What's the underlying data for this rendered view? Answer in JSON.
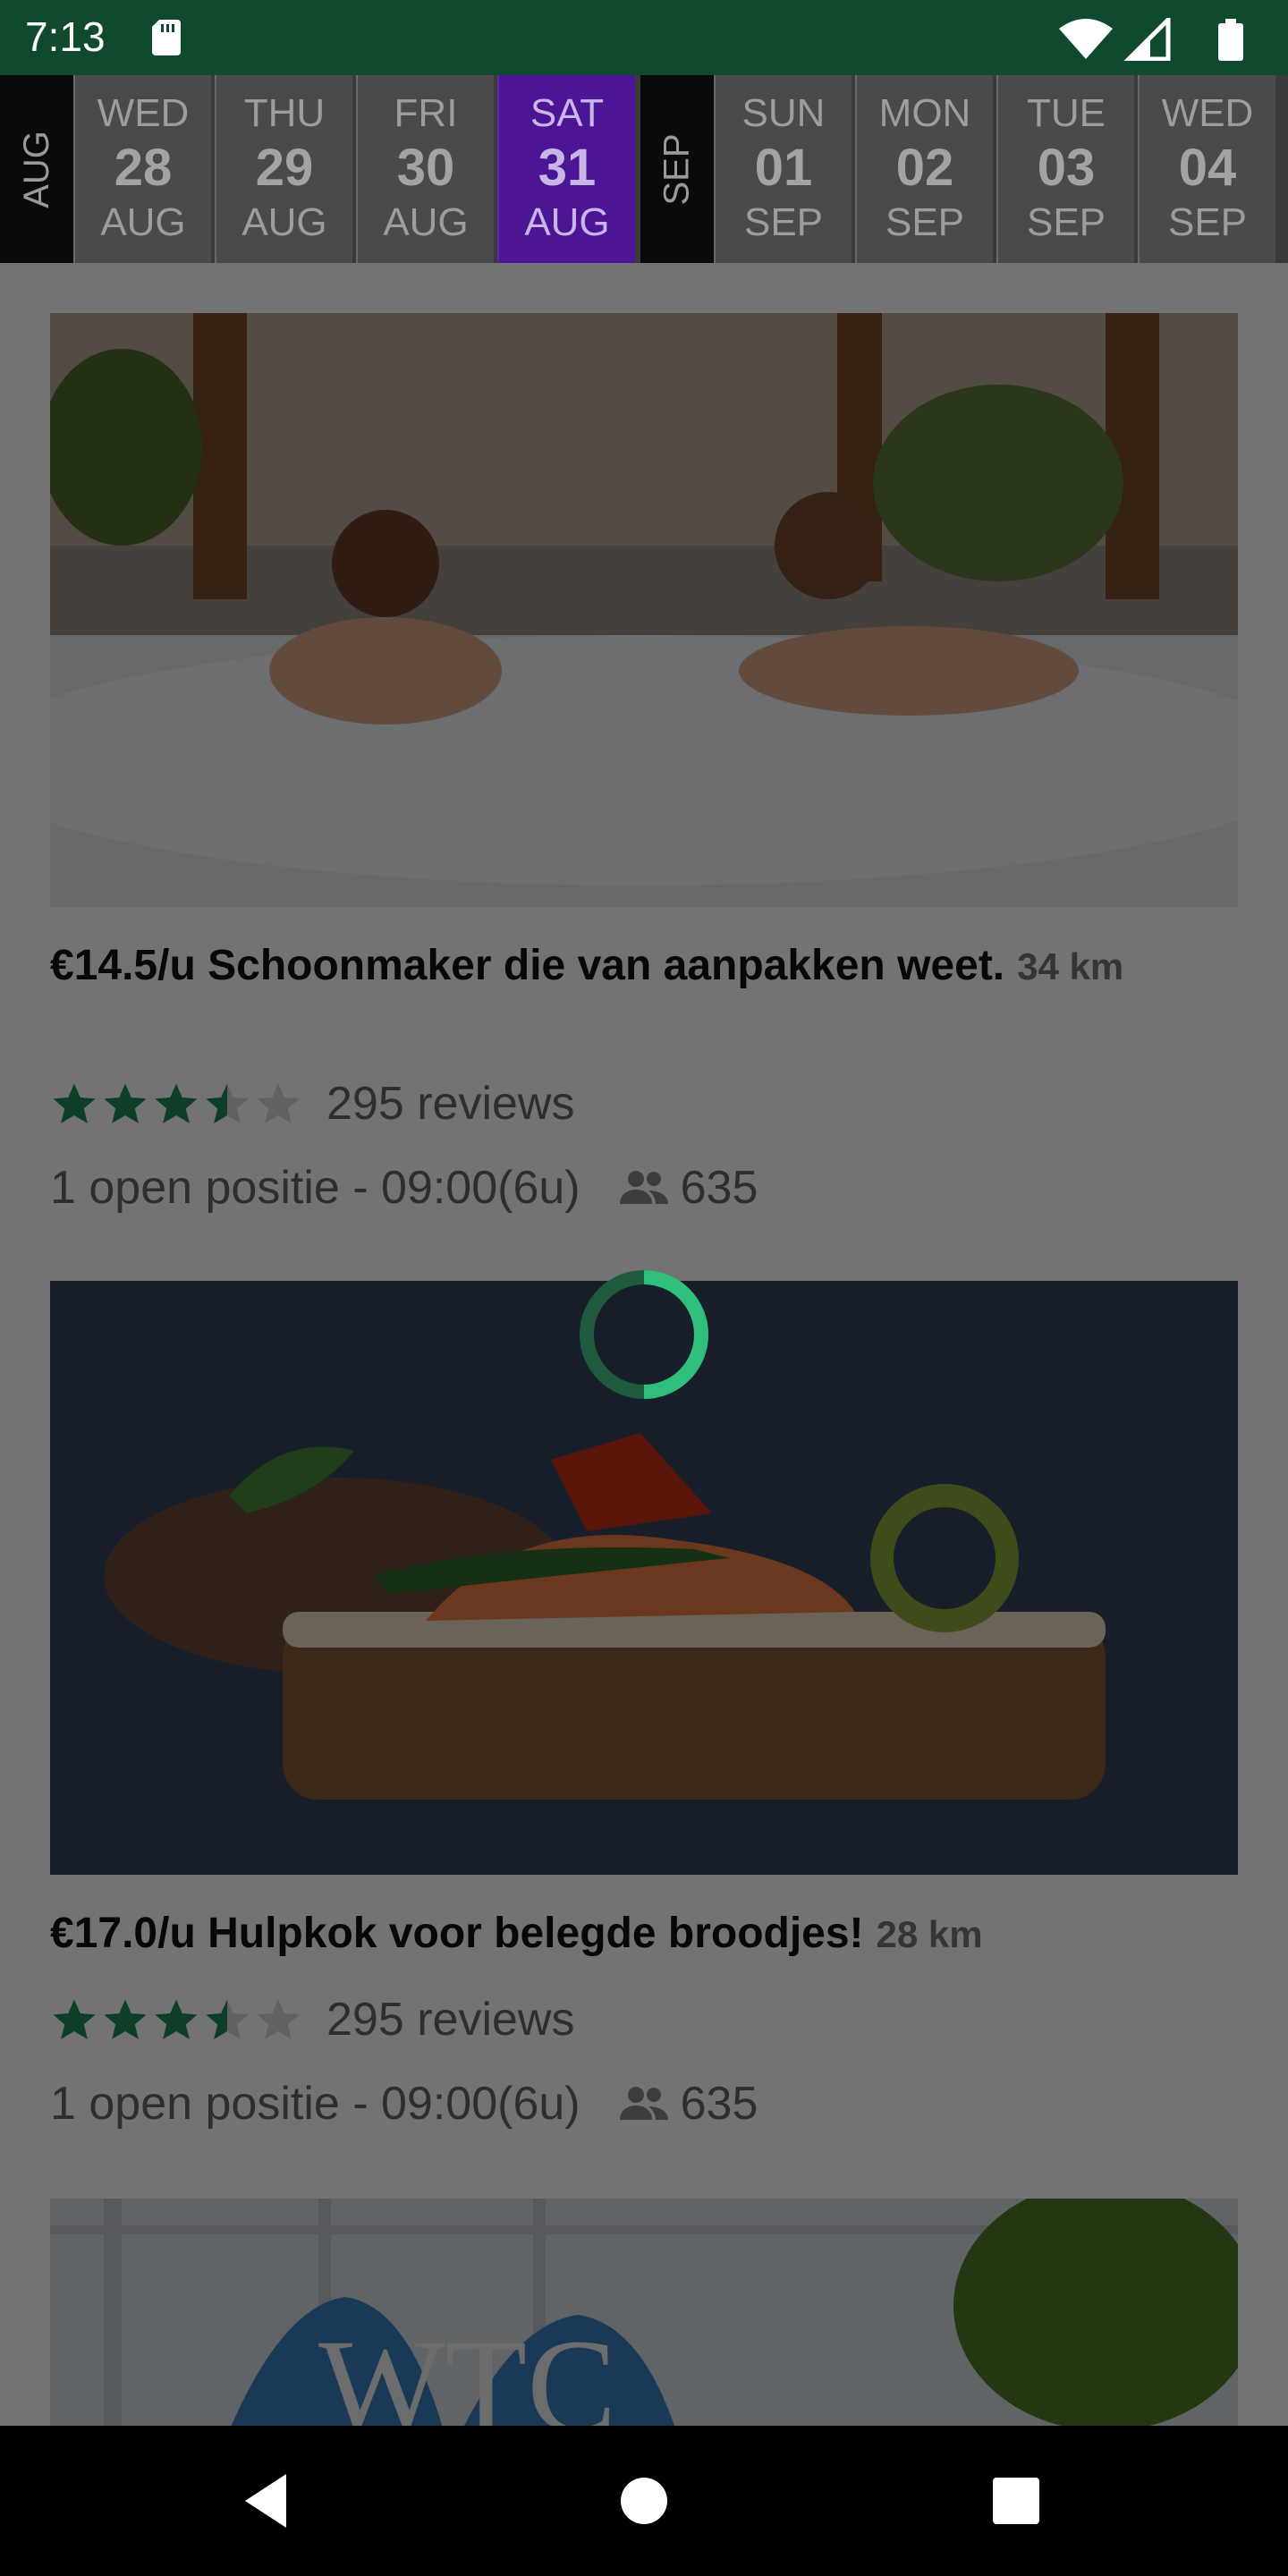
{
  "status_bar": {
    "time": "7:13"
  },
  "date_strip": {
    "months": [
      "AUG",
      "SEP"
    ],
    "days": [
      {
        "weekday": "WED",
        "day": "28",
        "month": "AUG",
        "selected": false
      },
      {
        "weekday": "THU",
        "day": "29",
        "month": "AUG",
        "selected": false
      },
      {
        "weekday": "FRI",
        "day": "30",
        "month": "AUG",
        "selected": false
      },
      {
        "weekday": "SAT",
        "day": "31",
        "month": "AUG",
        "selected": true
      },
      {
        "weekday": "SUN",
        "day": "01",
        "month": "SEP",
        "selected": false
      },
      {
        "weekday": "MON",
        "day": "02",
        "month": "SEP",
        "selected": false
      },
      {
        "weekday": "TUE",
        "day": "03",
        "month": "SEP",
        "selected": false
      },
      {
        "weekday": "WED",
        "day": "04",
        "month": "SEP",
        "selected": false
      }
    ]
  },
  "jobs": [
    {
      "title": "€14.5/u Schoonmaker die van aanpakken weet.",
      "distance": "34 km",
      "rating": 3.5,
      "reviews": "295 reviews",
      "positions": "1 open positie - 09:00(6u)",
      "people": "635",
      "image": "hot tub with two women"
    },
    {
      "title": "€17.0/u Hulpkok voor belegde broodjes!",
      "distance": "28 km",
      "rating": 3.5,
      "reviews": "295 reviews",
      "positions": "1 open positie - 09:00(6u)",
      "people": "635",
      "image": "salmon open sandwich"
    },
    {
      "image": "WTC building sign"
    }
  ],
  "colors": {
    "status_bar": "#0f4a2e",
    "selected_day": "#4b1595",
    "star": "#1f8a5a",
    "spinner": "#2fbf7a"
  }
}
